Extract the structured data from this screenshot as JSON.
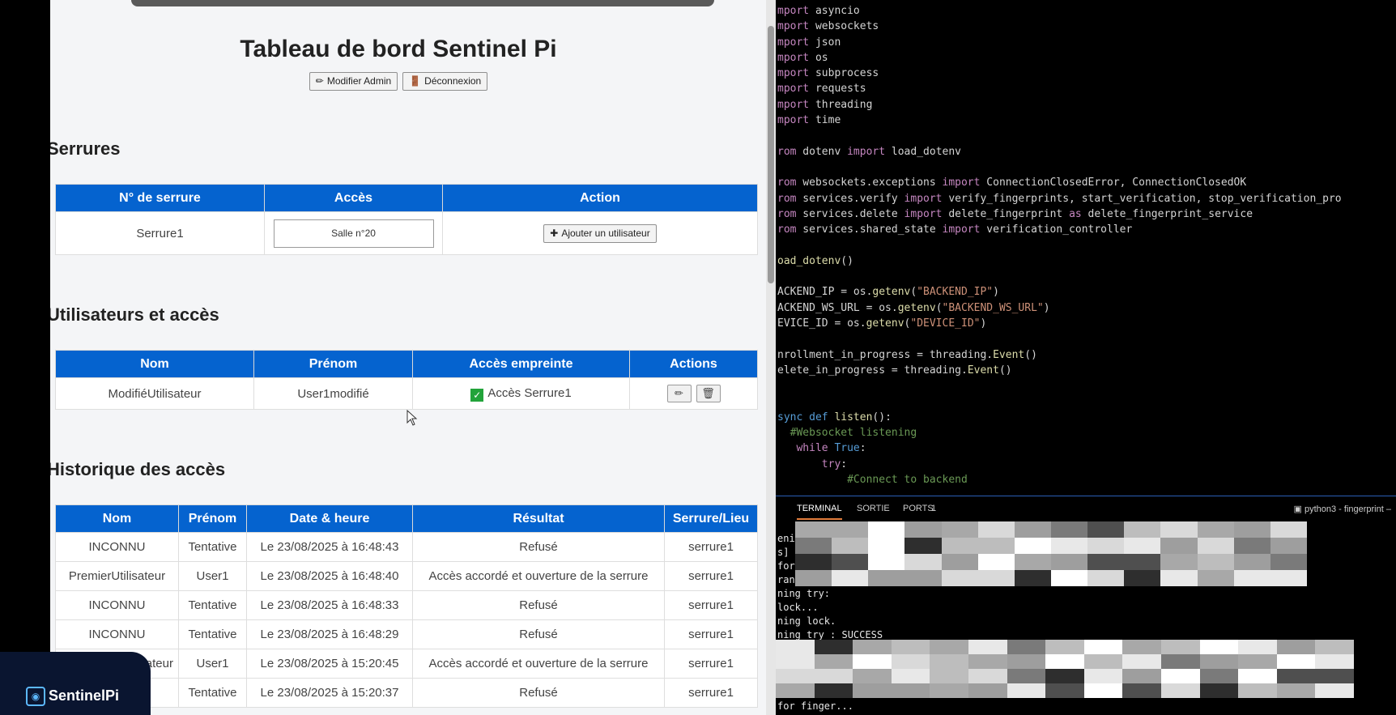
{
  "dashboard": {
    "title": "Tableau de bord Sentinel Pi",
    "edit_admin": "Modifier Admin",
    "logout": "Déconnexion"
  },
  "locks": {
    "heading": "Serrures",
    "columns": [
      "N° de serrure",
      "Accès",
      "Action"
    ],
    "row": {
      "name": "Serrure1",
      "access": "Salle n°20",
      "action": "Ajouter un utilisateur"
    }
  },
  "users": {
    "heading": "Utilisateurs et accès",
    "columns": [
      "Nom",
      "Prénom",
      "Accès empreinte",
      "Actions"
    ],
    "row": {
      "nom": "ModifiéUtilisateur",
      "prenom": "User1modifié",
      "acces": "Accès Serrure1"
    }
  },
  "history": {
    "heading": "Historique des accès",
    "columns": [
      "Nom",
      "Prénom",
      "Date & heure",
      "Résultat",
      "Serrure/Lieu"
    ],
    "rows": [
      [
        "INCONNU",
        "Tentative",
        "Le 23/08/2025 à 16:48:43",
        "Refusé",
        "serrure1"
      ],
      [
        "PremierUtilisateur",
        "User1",
        "Le 23/08/2025 à 16:48:40",
        "Accès accordé et ouverture de la serrure",
        "serrure1"
      ],
      [
        "INCONNU",
        "Tentative",
        "Le 23/08/2025 à 16:48:33",
        "Refusé",
        "serrure1"
      ],
      [
        "INCONNU",
        "Tentative",
        "Le 23/08/2025 à 16:48:29",
        "Refusé",
        "serrure1"
      ],
      [
        "ateur",
        "User1",
        "Le 23/08/2025 à 15:20:45",
        "Accès accordé et ouverture de la serrure",
        "serrure1"
      ],
      [
        "",
        "Tentative",
        "Le 23/08/2025 à 15:20:37",
        "Refusé",
        "serrure1"
      ]
    ]
  },
  "brand": {
    "name": "SentinelPi"
  },
  "editor": {
    "lines": [
      "mport asyncio",
      "mport websockets",
      "mport json",
      "mport os",
      "mport subprocess",
      "mport requests",
      "mport threading",
      "mport time",
      "",
      "rom dotenv import load_dotenv",
      "",
      "rom websockets.exceptions import ConnectionClosedError, ConnectionClosedOK",
      "rom services.verify import verify_fingerprints, start_verification, stop_verification_pro",
      "rom services.delete import delete_fingerprint as delete_fingerprint_service",
      "rom services.shared_state import verification_controller",
      "",
      "oad_dotenv()",
      "",
      "ACKEND_IP = os.getenv(\"BACKEND_IP\")",
      "ACKEND_WS_URL = os.getenv(\"BACKEND_WS_URL\")",
      "EVICE_ID = os.getenv(\"DEVICE_ID\")",
      "",
      "nrollment_in_progress = threading.Event()",
      "elete_in_progress = threading.Event()",
      "",
      "",
      "sync def listen():",
      "  #Websocket listening",
      "   while True:",
      "       try:",
      "           #Connect to backend"
    ]
  },
  "panel": {
    "terminal": "TERMINAL",
    "sortie": "SORTIE",
    "ports": "PORTS",
    "ports_count": "1",
    "python": "python3 - fingerprint"
  },
  "terminal": {
    "lines_top": [
      "eni",
      "s] ",
      "for",
      "ran"
    ],
    "lines_mid": [
      "ning try:",
      "lock...",
      "ning lock.",
      "ning try : SUCCESS"
    ],
    "lines_bottom": [
      "",
      "for finger..."
    ]
  }
}
